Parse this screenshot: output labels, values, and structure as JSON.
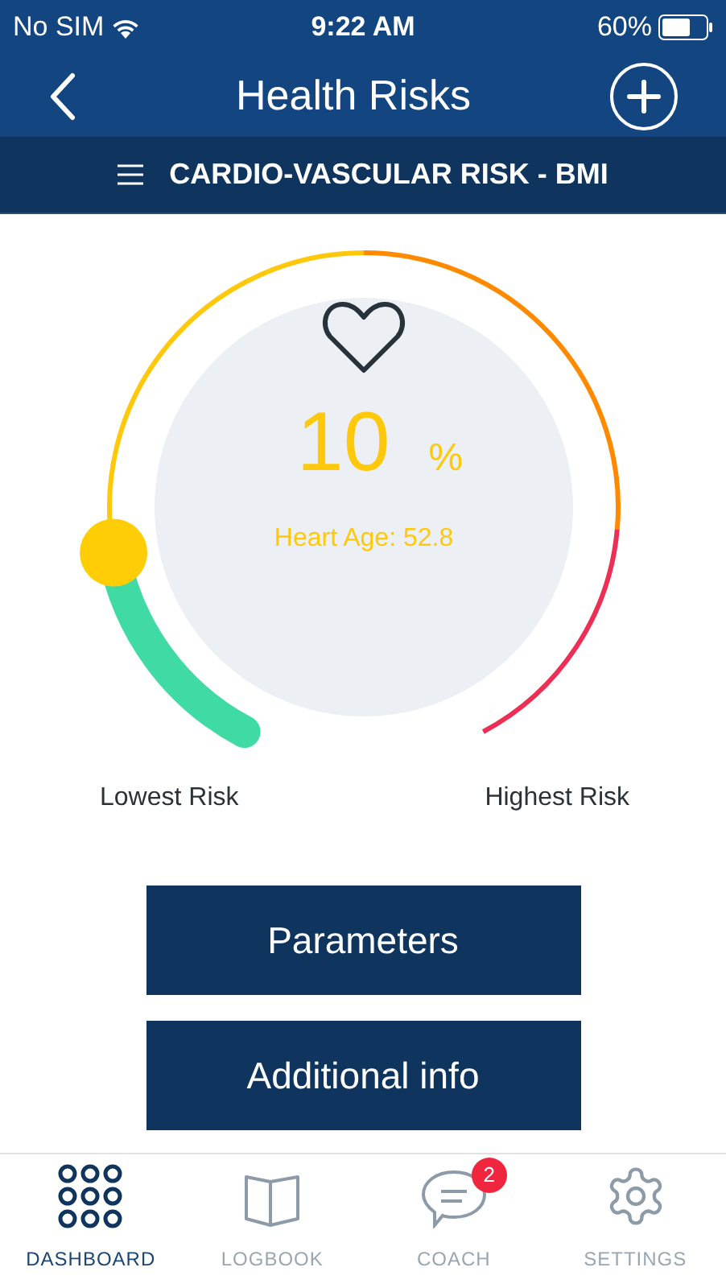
{
  "status_bar": {
    "carrier": "No SIM",
    "time": "9:22 AM",
    "battery": "60%"
  },
  "nav": {
    "title": "Health Risks"
  },
  "section": {
    "title": "CARDIO-VASCULAR RISK - BMI"
  },
  "gauge": {
    "value": "10",
    "unit": "%",
    "heart_age": "Heart Age: 52.8",
    "min_label": "Lowest Risk",
    "max_label": "Highest Risk"
  },
  "buttons": [
    "Parameters",
    "Additional info"
  ],
  "tabs": [
    {
      "label": "DASHBOARD",
      "kind": "grid",
      "selected": true
    },
    {
      "label": "LOGBOOK",
      "kind": "book",
      "selected": false
    },
    {
      "label": "COACH",
      "kind": "chat",
      "selected": false,
      "badge": "2"
    },
    {
      "label": "SETTINGS",
      "kind": "gear",
      "selected": false
    }
  ]
}
